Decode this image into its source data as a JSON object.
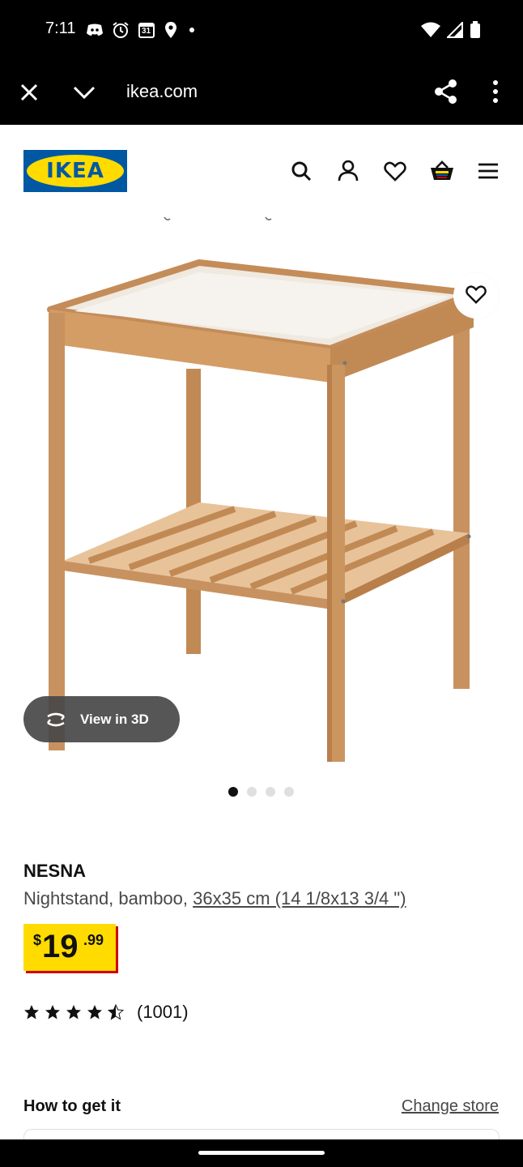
{
  "status_bar": {
    "time": "7:11",
    "left_icons": [
      "discord-icon",
      "alarm-icon",
      "calendar-icon",
      "location-icon",
      "dot-icon"
    ],
    "calendar_day": "31",
    "right_icons": [
      "wifi-icon",
      "signal-icon",
      "battery-icon"
    ]
  },
  "browser": {
    "url": "ikea.com",
    "icons": [
      "close-icon",
      "chevron-down-icon",
      "share-icon",
      "more-vert-icon"
    ]
  },
  "header": {
    "logo_text": "IKEA",
    "brand_colors": {
      "blue": "#0058a3",
      "yellow": "#ffdb00"
    },
    "icons": [
      "search-icon",
      "account-icon",
      "heart-icon",
      "basket-icon",
      "menu-icon"
    ]
  },
  "product": {
    "view3d_label": "View in 3D",
    "carousel": {
      "total": 4,
      "active": 0
    },
    "name": "NESNA",
    "description_prefix": "Nightstand, bamboo, ",
    "dimensions": "36x35 cm (14 1/8x13 3/4 \")",
    "price": {
      "currency": "$",
      "integer": "19",
      "decimals": ".99"
    },
    "price_colors": {
      "box": "#ffdb00",
      "shadow": "#cc0008"
    },
    "rating": {
      "value": 4.5,
      "max": 5,
      "count_label": "(1001)"
    }
  },
  "availability": {
    "title": "How to get it",
    "change_store_label": "Change store"
  }
}
